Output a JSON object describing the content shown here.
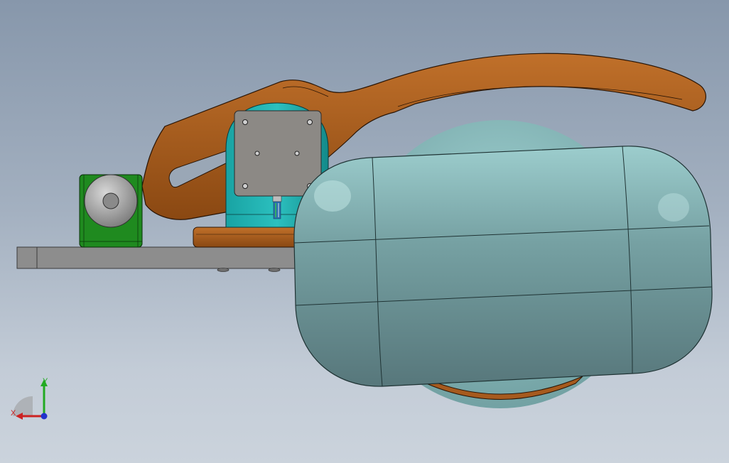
{
  "viewport": {
    "background": [
      "#8797ab",
      "#cbd3dc"
    ]
  },
  "model": {
    "parts": [
      {
        "name": "base-plate",
        "color": "#8d8d8d"
      },
      {
        "name": "lever-arm",
        "color": "#a65a1e"
      },
      {
        "name": "green-clamp-block",
        "color": "#1f8a1f"
      },
      {
        "name": "knob",
        "color": "#9a9a9a"
      },
      {
        "name": "motor-housing",
        "color": "#1fa5a5"
      },
      {
        "name": "motor-plate",
        "color": "#8c8985"
      },
      {
        "name": "wooden-pad",
        "color": "#a65a1e"
      },
      {
        "name": "disk",
        "color": "#7fb3b3"
      },
      {
        "name": "capsule-body",
        "color": "#7aa3a6"
      }
    ]
  },
  "triad": {
    "x_label": "X",
    "y_label": "Y",
    "x_color": "#cc2222",
    "y_color": "#22aa22",
    "z_color": "#2233cc"
  }
}
